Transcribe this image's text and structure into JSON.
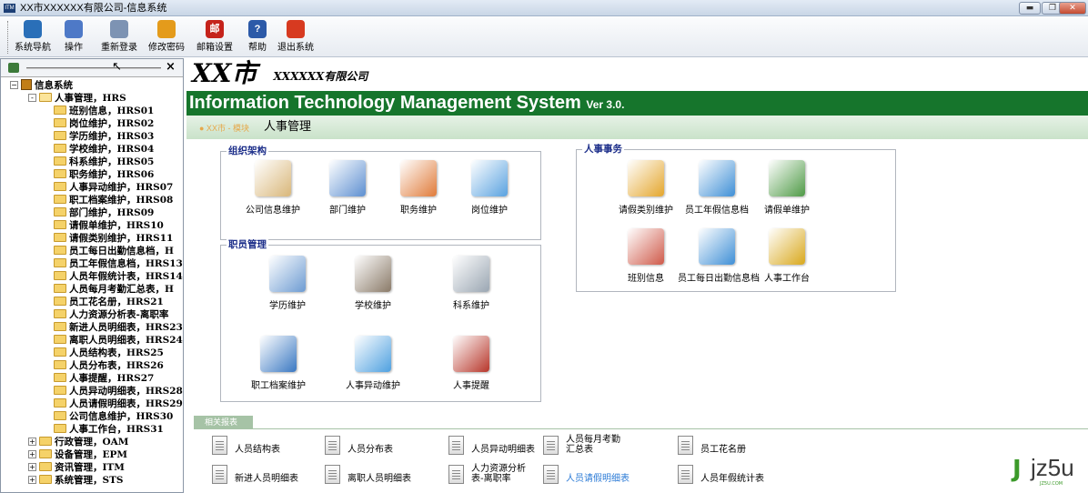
{
  "window": {
    "app_icon": "ITM",
    "title": "XX市XXXXXX有限公司-信息系统"
  },
  "toolbar": [
    {
      "label": "系统导航",
      "icon": "navigation-icon",
      "color": "#2a6fb8"
    },
    {
      "label": "操作",
      "icon": "operation-icon",
      "color": "#4e79c7"
    },
    {
      "label": "重新登录",
      "icon": "relogin-icon",
      "color": "#7d93b3"
    },
    {
      "label": "修改密码",
      "icon": "change-password-icon",
      "color": "#e49b1b"
    },
    {
      "label": "邮箱设置",
      "icon": "mailbox-icon",
      "color": "#c5231b",
      "glyph": "邮"
    },
    {
      "label": "帮助",
      "icon": "help-icon",
      "color": "#2c5aa8",
      "glyph": "?"
    },
    {
      "label": "退出系统",
      "icon": "exit-icon",
      "color": "#d73a20"
    }
  ],
  "tree": {
    "root": "信息系统",
    "nodes": [
      {
        "label": "人事管理，HRS",
        "level": 1,
        "expand": "-",
        "open": true
      },
      {
        "label": "班别信息，HRS01",
        "level": 2
      },
      {
        "label": "岗位维护，HRS02",
        "level": 2
      },
      {
        "label": "学历维护，HRS03",
        "level": 2
      },
      {
        "label": "学校维护，HRS04",
        "level": 2
      },
      {
        "label": "科系维护，HRS05",
        "level": 2
      },
      {
        "label": "职务维护，HRS06",
        "level": 2
      },
      {
        "label": "人事异动维护，HRS07",
        "level": 2
      },
      {
        "label": "职工档案维护，HRS08",
        "level": 2
      },
      {
        "label": "部门维护，HRS09",
        "level": 2
      },
      {
        "label": "请假单维护，HRS10",
        "level": 2
      },
      {
        "label": "请假类别维护，HRS11",
        "level": 2
      },
      {
        "label": "员工每日出勤信息档，H",
        "level": 2
      },
      {
        "label": "员工年假信息档，HRS13",
        "level": 2
      },
      {
        "label": "人员年假统计表，HRS14",
        "level": 2
      },
      {
        "label": "人员每月考勤汇总表，H",
        "level": 2
      },
      {
        "label": "员工花名册，HRS21",
        "level": 2
      },
      {
        "label": "人力资源分析表-离职率",
        "level": 2
      },
      {
        "label": "新进人员明细表，HRS23",
        "level": 2
      },
      {
        "label": "离职人员明细表，HRS24",
        "level": 2
      },
      {
        "label": "人员结构表，HRS25",
        "level": 2
      },
      {
        "label": "人员分布表，HRS26",
        "level": 2
      },
      {
        "label": "人事提醒，HRS27",
        "level": 2
      },
      {
        "label": "人员异动明细表，HRS28",
        "level": 2
      },
      {
        "label": "人员请假明细表，HRS29",
        "level": 2
      },
      {
        "label": "公司信息维护，HRS30",
        "level": 2
      },
      {
        "label": "人事工作台，HRS31",
        "level": 2
      },
      {
        "label": "行政管理，OAM",
        "level": 1,
        "expand": "+"
      },
      {
        "label": "设备管理，EPM",
        "level": 1,
        "expand": "+"
      },
      {
        "label": "资讯管理，ITM",
        "level": 1,
        "expand": "+"
      },
      {
        "label": "系统管理，STS",
        "level": 1,
        "expand": "+"
      }
    ]
  },
  "header": {
    "logo_city": "XX市",
    "logo_company": "XXXXXX有限公司",
    "system_name": "Information Technology Management System",
    "version": "Ver 3.0.",
    "breadcrumb": "● XX市 - 模块",
    "module_title": "人事管理"
  },
  "groups": {
    "org": {
      "title": "组织架构",
      "items": [
        {
          "label": "公司信息维护",
          "icon": "company-info-icon",
          "color": "#d9b77a"
        },
        {
          "label": "部门维护",
          "icon": "department-icon",
          "color": "#5d8fd1"
        },
        {
          "label": "职务维护",
          "icon": "position-icon",
          "color": "#e07b3a"
        },
        {
          "label": "岗位维护",
          "icon": "post-icon",
          "color": "#5aa2e0"
        }
      ]
    },
    "staff": {
      "title": "职员管理",
      "items": [
        {
          "label": "学历维护",
          "icon": "education-icon",
          "color": "#6d9bd2"
        },
        {
          "label": "学校维护",
          "icon": "school-icon",
          "color": "#8a7a68"
        },
        {
          "label": "科系维护",
          "icon": "department-subject-icon",
          "color": "#9aa6b2"
        },
        {
          "label": "职工档案维护",
          "icon": "employee-file-icon",
          "color": "#3a78c2"
        },
        {
          "label": "人事异动维护",
          "icon": "personnel-change-icon",
          "color": "#4ea0e0"
        },
        {
          "label": "人事提醒",
          "icon": "calendar-reminder-icon",
          "color": "#b7362a"
        }
      ]
    },
    "affairs": {
      "title": "人事事务",
      "items": [
        {
          "label": "请假类别维护",
          "icon": "leave-type-icon",
          "color": "#e4a62d"
        },
        {
          "label": "员工年假信息档",
          "icon": "annual-leave-icon",
          "color": "#3f8fd6"
        },
        {
          "label": "请假单维护",
          "icon": "leave-form-icon",
          "color": "#4f9a46"
        },
        {
          "label": "班别信息",
          "icon": "shift-info-icon",
          "color": "#cf5a4a"
        },
        {
          "label": "员工每日出勤信息档",
          "icon": "daily-attendance-icon",
          "color": "#3f8fd6"
        },
        {
          "label": "人事工作台",
          "icon": "hr-workbench-icon",
          "color": "#d9a81c"
        }
      ]
    }
  },
  "reports": {
    "title": "相关报表",
    "row1": [
      "人员结构表",
      "人员分布表",
      "人员异动明细表",
      "人员每月考勤汇总表",
      "员工花名册"
    ],
    "row2": [
      "新进人员明细表",
      "离职人员明细表",
      "人力资源分析表-离职率",
      "人员请假明细表",
      "人员年假统计表"
    ],
    "active": "人员请假明细表",
    "active_color": "#2c7bd6"
  },
  "watermark": {
    "main": "jz5u",
    "sub": "JZ5U.COM"
  }
}
